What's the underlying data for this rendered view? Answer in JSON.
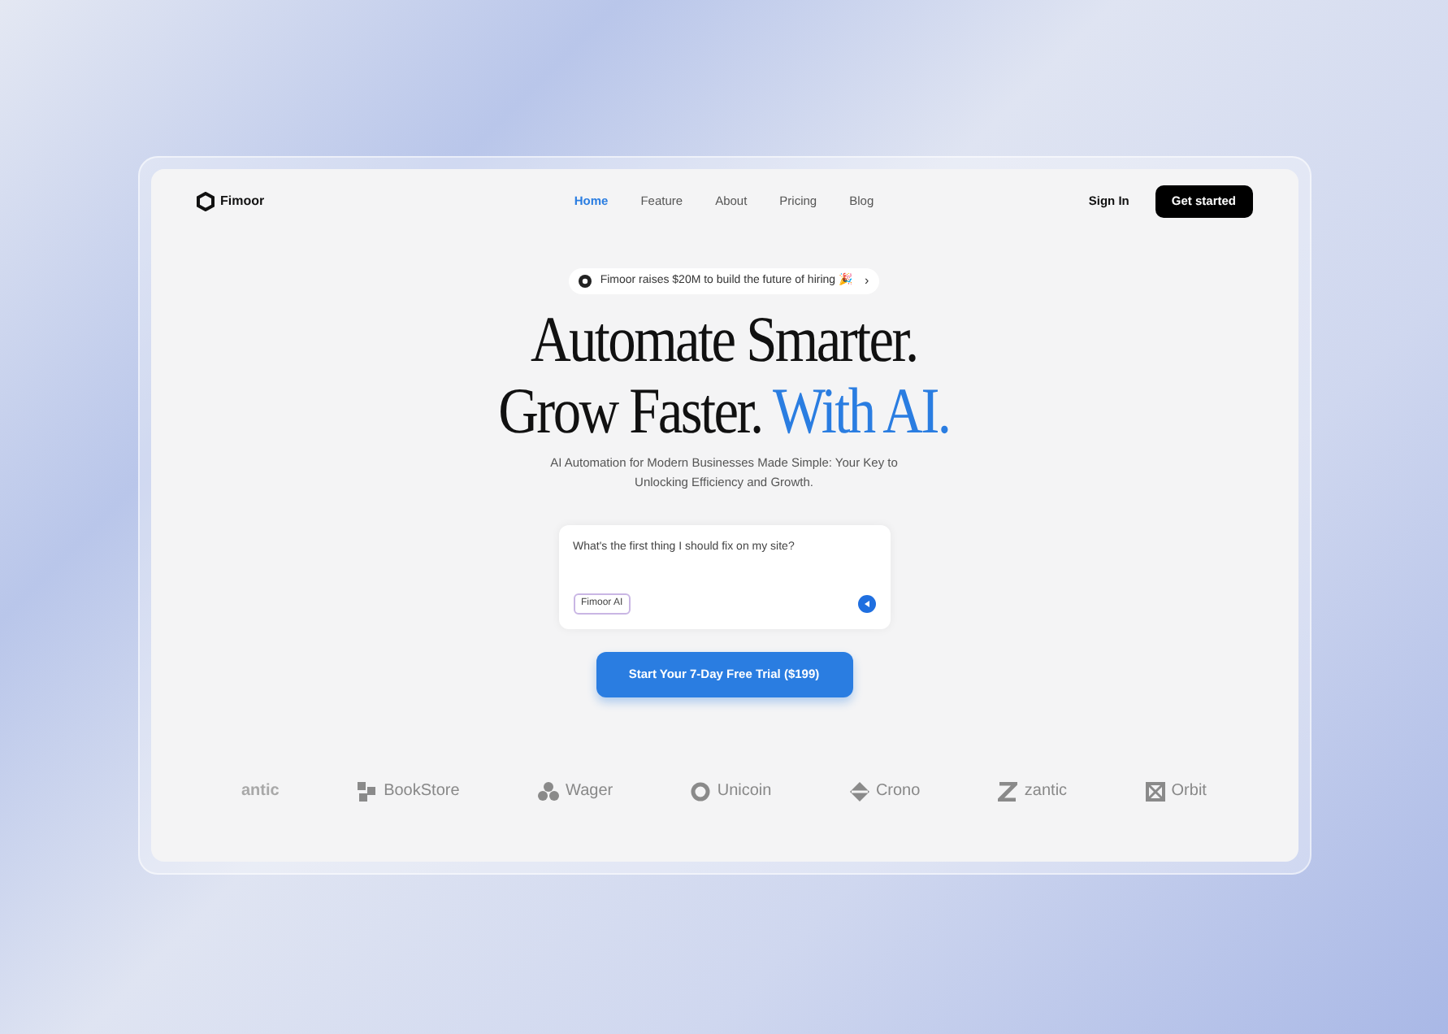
{
  "brand": {
    "name": "Fimoor"
  },
  "nav": [
    {
      "label": "Home",
      "selected": true
    },
    {
      "label": "Feature",
      "selected": false
    },
    {
      "label": "About",
      "selected": false
    },
    {
      "label": "Pricing",
      "selected": false
    },
    {
      "label": "Blog",
      "selected": false
    }
  ],
  "actions": {
    "sign_in": "Sign In",
    "get_started": "Get started"
  },
  "announcement": {
    "text": "Fimoor raises $20M to build the future of hiring 🎉",
    "arrow": "›"
  },
  "headline": {
    "line_1": "Automate Smarter.",
    "line_2": "Grow Faster.",
    "highlight": "With AI."
  },
  "subtitle": "AI Automation for Modern Businesses Made Simple: Your Key to Unlocking Efficiency and Growth.",
  "prompt": {
    "value": "What's the first thing I should fix on my site?",
    "tag": "Fimoor AI"
  },
  "cta": "Start Your 7-Day Free Trial ($199)",
  "logos": [
    {
      "kind": "faded",
      "name": "antic"
    },
    {
      "kind": "blocks",
      "name": "BookStore"
    },
    {
      "kind": "clover",
      "name": "Wager"
    },
    {
      "kind": "ring",
      "name": "Unicoin"
    },
    {
      "kind": "diamond",
      "name": "Crono"
    },
    {
      "kind": "zigzag",
      "name": "zantic"
    },
    {
      "kind": "square",
      "name": "Orbit"
    }
  ]
}
